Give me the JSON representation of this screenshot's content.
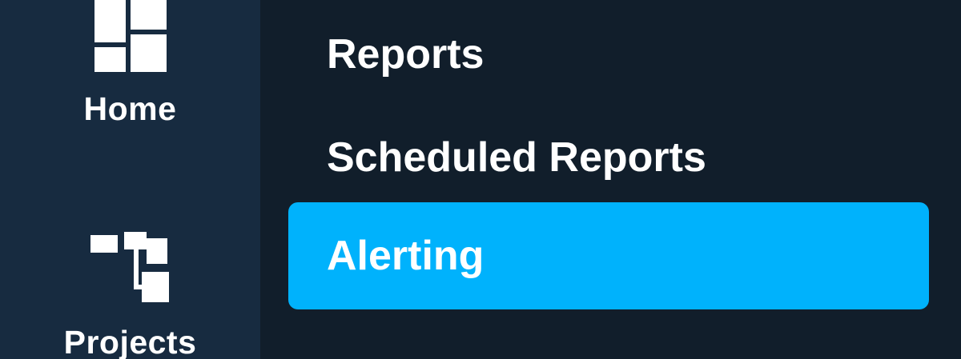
{
  "nav_rail": {
    "items": [
      {
        "label": "Home",
        "icon": "home-grid-icon"
      },
      {
        "label": "Projects",
        "icon": "projects-hierarchy-icon"
      }
    ]
  },
  "submenu": {
    "items": [
      {
        "label": "Reports",
        "active": false
      },
      {
        "label": "Scheduled Reports",
        "active": false
      },
      {
        "label": "Alerting",
        "active": true
      }
    ]
  },
  "colors": {
    "rail_background": "#172b40",
    "submenu_background": "#111e2b",
    "active_highlight": "#00b2fc",
    "text": "#ffffff"
  }
}
